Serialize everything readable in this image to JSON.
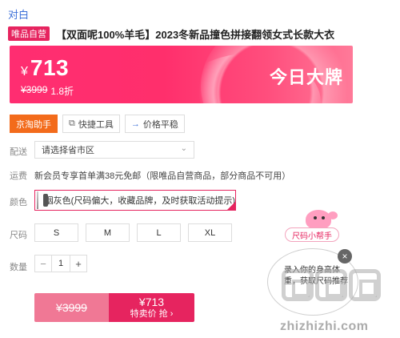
{
  "header": {
    "brand": "对白",
    "self_badge": "唯品自营",
    "title": "【双面呢100%羊毛】2023冬新品撞色拼接翻领女式长款大衣"
  },
  "price": {
    "currency": "¥",
    "current": "713",
    "original": "¥3999",
    "discount": "1.8折",
    "badge": "今日大牌",
    "accent": "#ff2d71"
  },
  "tabs": [
    {
      "label": "京淘助手",
      "icon": "none"
    },
    {
      "label": "快捷工具",
      "icon": "copy-icon"
    },
    {
      "label": "价格平稳",
      "icon": "arrow-right-icon"
    }
  ],
  "shipping_to": {
    "label": "配送",
    "placeholder": "请选择省市区"
  },
  "freight": {
    "label": "运费",
    "text": "新会员专享首单满38元免邮（限唯品自营商品，部分商品不可用）"
  },
  "color": {
    "label": "颜色",
    "option": "烟灰色(尺码偏大，收藏品牌，及时获取活动提示)"
  },
  "size": {
    "label": "尺码",
    "options": [
      "S",
      "M",
      "L",
      "XL"
    ]
  },
  "quantity": {
    "label": "数量",
    "minus": "−",
    "value": "1",
    "plus": "+"
  },
  "buy": {
    "original": "¥3999",
    "price": "¥713",
    "cta": "特卖价 抢 ›"
  },
  "helper": {
    "pill": "尺码小帮手",
    "bubble_text": "录入你的身高体重，获取尺码推荐"
  },
  "watermark": {
    "text": "zhizhizhi.com"
  }
}
